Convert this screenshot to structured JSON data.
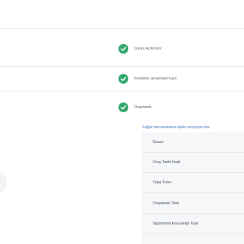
{
  "statuses": [
    {
      "label": "Dosya Açılmıştır.",
      "icon": "check-circle-icon"
    },
    {
      "label": "İnceleme tamamlanmıştır.",
      "icon": "check-circle-icon"
    },
    {
      "label": "Onaylandı.",
      "icon": "check-circle-icon"
    }
  ],
  "provision_link": "Sağlık harcamalarına ilişkin provizyon tale",
  "details": {
    "rows": [
      {
        "label": "Durum"
      },
      {
        "label": "Onay Tarihi Saati"
      },
      {
        "label": "Talep Tutarı"
      },
      {
        "label": "Onaylanan Tutar"
      },
      {
        "label": "Sigortalının Karşıladığı Tutar"
      }
    ]
  },
  "colors": {
    "check_green": "#2fa66a",
    "link_blue": "#2f6fb6",
    "divider": "#e6e9ed"
  }
}
